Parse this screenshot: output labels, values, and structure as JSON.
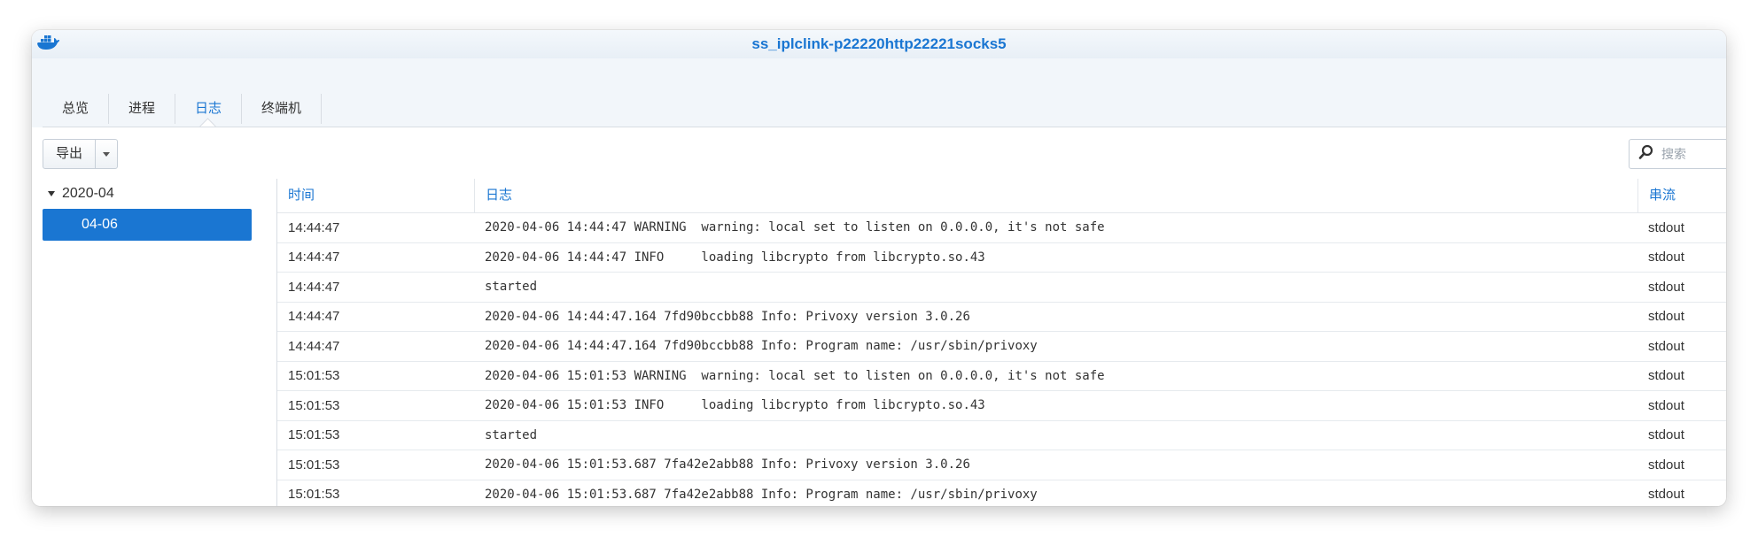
{
  "window": {
    "title": "ss_iplclink-p22220http22221socks5",
    "logo_icon": "docker-whale-icon",
    "accent_color": "#1a76d2"
  },
  "tabs": [
    {
      "label": "总览",
      "active": false
    },
    {
      "label": "进程",
      "active": false
    },
    {
      "label": "日志",
      "active": true
    },
    {
      "label": "终端机",
      "active": false
    }
  ],
  "toolbar": {
    "export_label": "导出",
    "search_placeholder": "搜索"
  },
  "sidebar": {
    "group_label": "2020-04",
    "selected_item": "04-06"
  },
  "table": {
    "columns": {
      "time": "时间",
      "log": "日志",
      "stream": "串流"
    },
    "rows": [
      {
        "time": "14:44:47",
        "log": "2020-04-06 14:44:47 WARNING  warning: local set to listen on 0.0.0.0, it's not safe",
        "stream": "stdout"
      },
      {
        "time": "14:44:47",
        "log": "2020-04-06 14:44:47 INFO     loading libcrypto from libcrypto.so.43",
        "stream": "stdout"
      },
      {
        "time": "14:44:47",
        "log": "started",
        "stream": "stdout"
      },
      {
        "time": "14:44:47",
        "log": "2020-04-06 14:44:47.164 7fd90bccbb88 Info: Privoxy version 3.0.26",
        "stream": "stdout"
      },
      {
        "time": "14:44:47",
        "log": "2020-04-06 14:44:47.164 7fd90bccbb88 Info: Program name: /usr/sbin/privoxy",
        "stream": "stdout"
      },
      {
        "time": "15:01:53",
        "log": "2020-04-06 15:01:53 WARNING  warning: local set to listen on 0.0.0.0, it's not safe",
        "stream": "stdout"
      },
      {
        "time": "15:01:53",
        "log": "2020-04-06 15:01:53 INFO     loading libcrypto from libcrypto.so.43",
        "stream": "stdout"
      },
      {
        "time": "15:01:53",
        "log": "started",
        "stream": "stdout"
      },
      {
        "time": "15:01:53",
        "log": "2020-04-06 15:01:53.687 7fa42e2abb88 Info: Privoxy version 3.0.26",
        "stream": "stdout"
      },
      {
        "time": "15:01:53",
        "log": "2020-04-06 15:01:53.687 7fa42e2abb88 Info: Program name: /usr/sbin/privoxy",
        "stream": "stdout"
      }
    ]
  }
}
